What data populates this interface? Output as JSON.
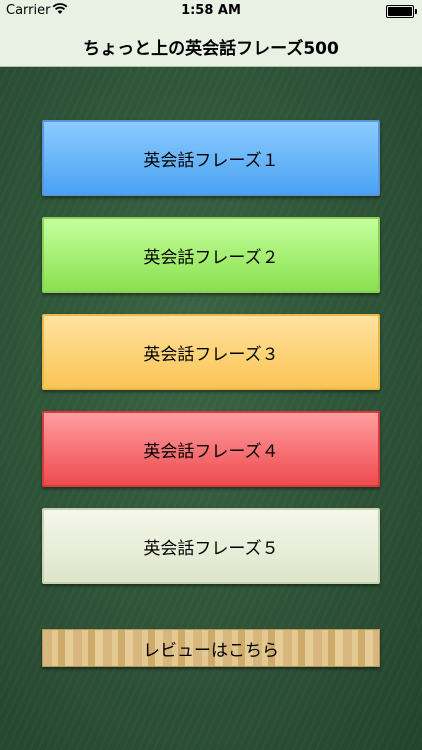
{
  "status_bar": {
    "carrier": "Carrier",
    "time": "1:58 AM",
    "wifi_icon": "wifi-icon",
    "battery_icon": "battery-icon",
    "battery_level": 0.91
  },
  "nav": {
    "title": "ちょっと上の英会話フレーズ500"
  },
  "menu": {
    "buttons": [
      {
        "label": "英会話フレーズ１",
        "color": "#4aa3f3"
      },
      {
        "label": "英会話フレーズ２",
        "color": "#8ae04f"
      },
      {
        "label": "英会話フレーズ３",
        "color": "#fbc454"
      },
      {
        "label": "英会話フレーズ４",
        "color": "#ee4b4f"
      },
      {
        "label": "英会話フレーズ５",
        "color": "#dde5c9"
      }
    ],
    "review_label": "レビューはこちら"
  },
  "colors": {
    "chalkboard": "#2d4f38",
    "nav_background": "#e9f0e4"
  }
}
